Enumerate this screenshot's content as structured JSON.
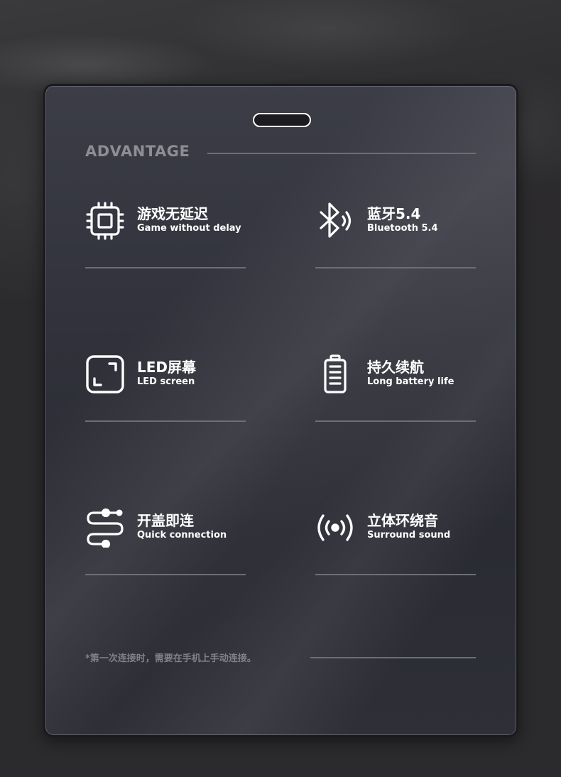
{
  "heading": "ADVANTAGE",
  "features": [
    {
      "title": "游戏无延迟",
      "subtitle": "Game without delay",
      "icon": "chip-icon"
    },
    {
      "title": "蓝牙5.4",
      "subtitle": "Bluetooth 5.4",
      "icon": "bluetooth-icon"
    },
    {
      "title": "LED屏幕",
      "subtitle": "LED screen",
      "icon": "screen-icon"
    },
    {
      "title": "持久续航",
      "subtitle": "Long battery life",
      "icon": "battery-icon"
    },
    {
      "title": "开盖即连",
      "subtitle": "Quick connection",
      "icon": "connection-icon"
    },
    {
      "title": "立体环绕音",
      "subtitle": "Surround sound",
      "icon": "surround-sound-icon"
    }
  ],
  "footnote": "*第一次连接时，需要在手机上手动连接。",
  "colors": {
    "background": "#2b2a2c",
    "card": "#30313a",
    "heading": "#8d8e95",
    "text": "#ffffff",
    "rule": "#6d6e76"
  }
}
